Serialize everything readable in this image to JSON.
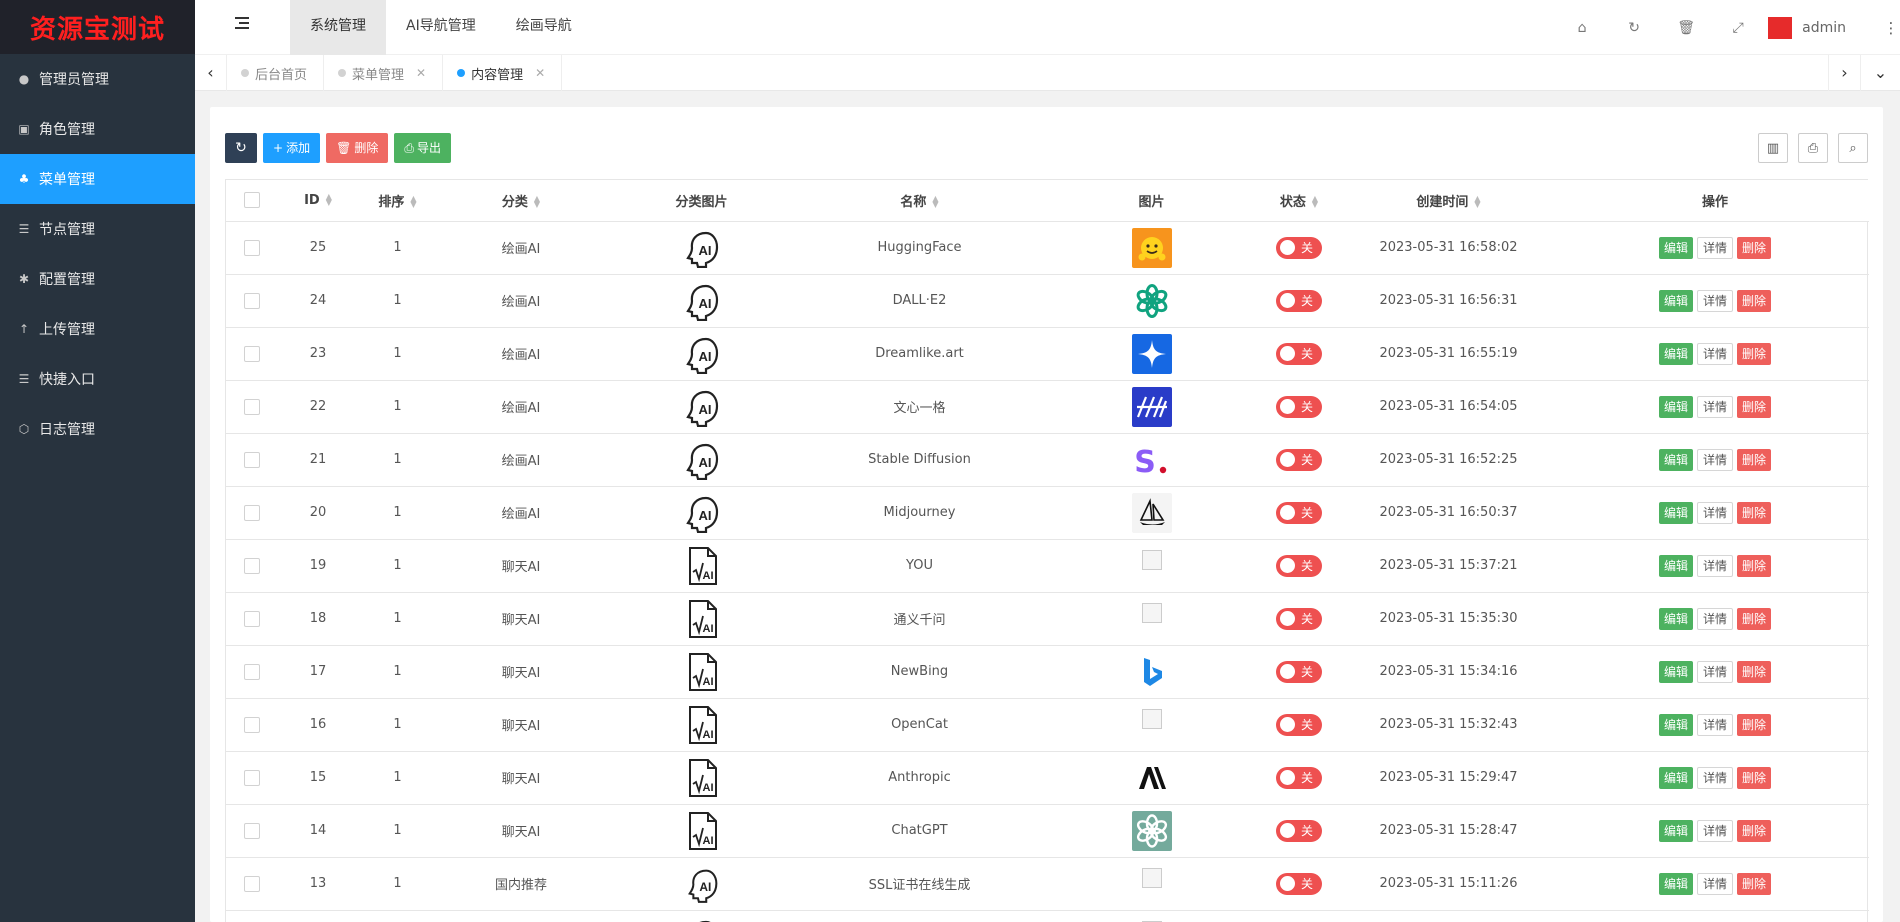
{
  "brand": {
    "logo_text": "资源宝测试"
  },
  "sidebar": {
    "items": [
      {
        "label": "管理员管理",
        "icon": "user-icon",
        "glyph": "●"
      },
      {
        "label": "角色管理",
        "icon": "role-icon",
        "glyph": "▣"
      },
      {
        "label": "菜单管理",
        "icon": "tree-icon",
        "glyph": "♣",
        "active": true
      },
      {
        "label": "节点管理",
        "icon": "list-icon",
        "glyph": "☰"
      },
      {
        "label": "配置管理",
        "icon": "gear-icon",
        "glyph": "✱"
      },
      {
        "label": "上传管理",
        "icon": "upload-icon",
        "glyph": "↑"
      },
      {
        "label": "快捷入口",
        "icon": "list-icon",
        "glyph": "☰"
      },
      {
        "label": "日志管理",
        "icon": "log-icon",
        "glyph": "⬡"
      }
    ]
  },
  "header": {
    "tabs": [
      {
        "label": "系统管理",
        "active": true
      },
      {
        "label": "AI导航管理"
      },
      {
        "label": "绘画导航"
      }
    ],
    "username": "admin"
  },
  "tabbar": {
    "tabs": [
      {
        "label": "后台首页",
        "closable": false
      },
      {
        "label": "菜单管理",
        "closable": true
      },
      {
        "label": "内容管理",
        "closable": true,
        "active": true
      }
    ]
  },
  "toolbar": {
    "add_label": "添加",
    "delete_label": "删除",
    "export_label": "导出"
  },
  "table": {
    "columns": {
      "id": "ID",
      "sort": "排序",
      "category": "分类",
      "category_image": "分类图片",
      "name": "名称",
      "image": "图片",
      "status": "状态",
      "created": "创建时间",
      "actions": "操作"
    },
    "status_off_label": "关",
    "action_labels": {
      "edit": "编辑",
      "detail": "详情",
      "delete": "删除"
    },
    "rows": [
      {
        "id": "25",
        "sort": "1",
        "category": "绘画AI",
        "cat_icon": "ai-head",
        "name": "HuggingFace",
        "logo": "huggingface",
        "created": "2023-05-31 16:58:02"
      },
      {
        "id": "24",
        "sort": "1",
        "category": "绘画AI",
        "cat_icon": "ai-head",
        "name": "DALL·E2",
        "logo": "openai-green",
        "created": "2023-05-31 16:56:31"
      },
      {
        "id": "23",
        "sort": "1",
        "category": "绘画AI",
        "cat_icon": "ai-head",
        "name": "Dreamlike.art",
        "logo": "dreamlike",
        "created": "2023-05-31 16:55:19"
      },
      {
        "id": "22",
        "sort": "1",
        "category": "绘画AI",
        "cat_icon": "ai-head",
        "name": "文心一格",
        "logo": "wenxin",
        "created": "2023-05-31 16:54:05"
      },
      {
        "id": "21",
        "sort": "1",
        "category": "绘画AI",
        "cat_icon": "ai-head",
        "name": "Stable Diffusion",
        "logo": "stability",
        "created": "2023-05-31 16:52:25"
      },
      {
        "id": "20",
        "sort": "1",
        "category": "绘画AI",
        "cat_icon": "ai-head",
        "name": "Midjourney",
        "logo": "midjourney",
        "created": "2023-05-31 16:50:37"
      },
      {
        "id": "19",
        "sort": "1",
        "category": "聊天AI",
        "cat_icon": "ai-doc",
        "name": "YOU",
        "logo": "broken",
        "created": "2023-05-31 15:37:21"
      },
      {
        "id": "18",
        "sort": "1",
        "category": "聊天AI",
        "cat_icon": "ai-doc",
        "name": "通义千问",
        "logo": "broken",
        "created": "2023-05-31 15:35:30"
      },
      {
        "id": "17",
        "sort": "1",
        "category": "聊天AI",
        "cat_icon": "ai-doc",
        "name": "NewBing",
        "logo": "bing",
        "created": "2023-05-31 15:34:16"
      },
      {
        "id": "16",
        "sort": "1",
        "category": "聊天AI",
        "cat_icon": "ai-doc",
        "name": "OpenCat",
        "logo": "broken",
        "created": "2023-05-31 15:32:43"
      },
      {
        "id": "15",
        "sort": "1",
        "category": "聊天AI",
        "cat_icon": "ai-doc",
        "name": "Anthropic",
        "logo": "anthropic",
        "created": "2023-05-31 15:29:47"
      },
      {
        "id": "14",
        "sort": "1",
        "category": "聊天AI",
        "cat_icon": "ai-doc",
        "name": "ChatGPT",
        "logo": "openai-teal",
        "created": "2023-05-31 15:28:47"
      },
      {
        "id": "13",
        "sort": "1",
        "category": "国内推荐",
        "cat_icon": "ai-head-small",
        "name": "SSL证书在线生成",
        "logo": "broken",
        "created": "2023-05-31 15:11:26"
      },
      {
        "id": "",
        "sort": "",
        "category": "",
        "cat_icon": "ai-head",
        "name": "",
        "logo": "broken",
        "created": ""
      }
    ]
  },
  "colors": {
    "sidebar_bg": "#28333e",
    "accent": "#1e9fff",
    "logo_red": "#ff1f1f",
    "switch_off": "#ee5050",
    "edit_green": "#4db260",
    "delete_red": "#ee5f5b"
  }
}
